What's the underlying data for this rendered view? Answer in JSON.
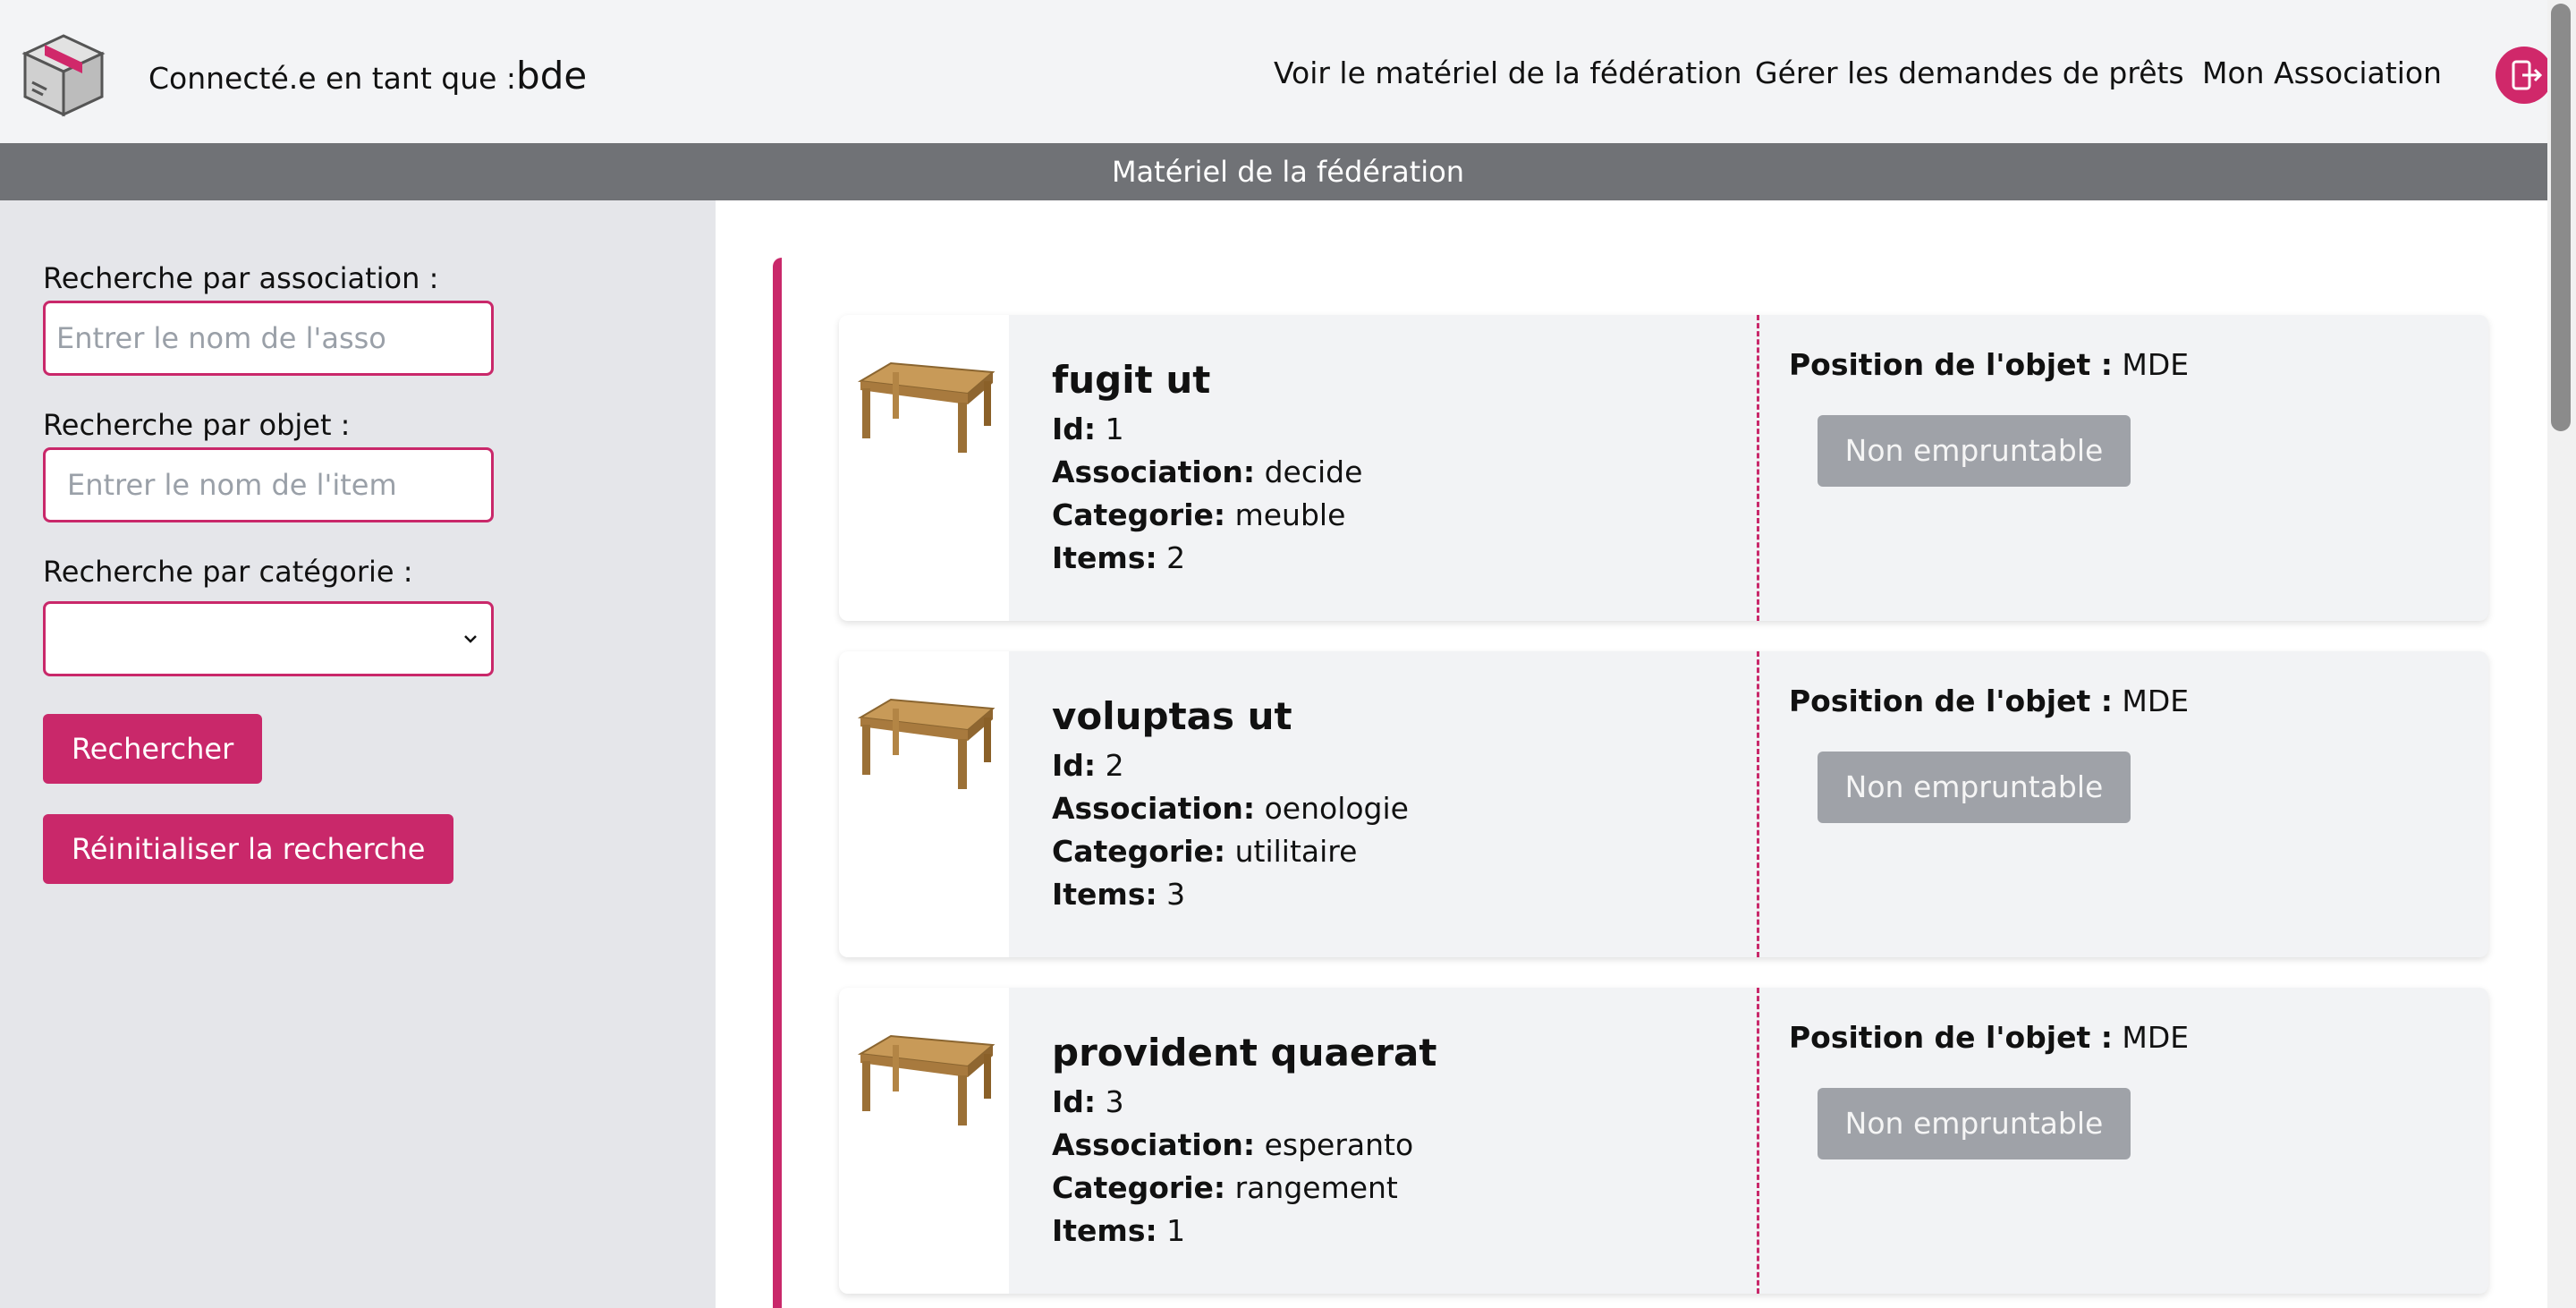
{
  "header": {
    "connected_prefix": "Connecté.e en tant que :",
    "username": "bde",
    "nav": [
      {
        "label": "Voir le matériel de la fédération"
      },
      {
        "label": "Gérer les demandes de prêts"
      },
      {
        "label": "Mon Association"
      }
    ],
    "logout_icon": "logout-icon",
    "logo_icon": "box-icon"
  },
  "page_title": "Matériel de la fédération",
  "sidebar": {
    "assoc_label": "Recherche par association :",
    "assoc_placeholder": "Entrer le nom de l'asso",
    "object_label": "Recherche par objet :",
    "object_placeholder": "Entrer le nom de l'item",
    "category_label": "Recherche par catégorie :",
    "category_value": "",
    "search_button": "Rechercher",
    "reset_button": "Réinitialiser la recherche"
  },
  "field_labels": {
    "id": "Id:",
    "association": "Association:",
    "categorie": "Categorie:",
    "items": "Items:",
    "position": "Position de l'objet :"
  },
  "items": [
    {
      "name": "fugit ut",
      "id": "1",
      "association": "decide",
      "categorie": "meuble",
      "items": "2",
      "position": "MDE",
      "status": "Non empruntable"
    },
    {
      "name": "voluptas ut",
      "id": "2",
      "association": "oenologie",
      "categorie": "utilitaire",
      "items": "3",
      "position": "MDE",
      "status": "Non empruntable"
    },
    {
      "name": "provident quaerat",
      "id": "3",
      "association": "esperanto",
      "categorie": "rangement",
      "items": "1",
      "position": "MDE",
      "status": "Non empruntable"
    }
  ],
  "colors": {
    "accent": "#c9286a",
    "band": "#707276",
    "sidebar_bg": "#e5e6ea",
    "disabled_button": "#9fa2a8"
  }
}
